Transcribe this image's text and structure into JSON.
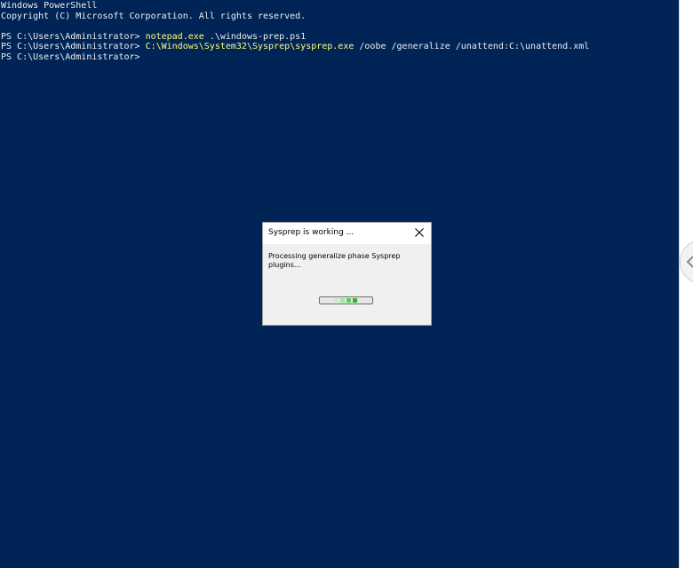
{
  "console": {
    "lines": [
      {
        "prompt": "Windows PowerShell",
        "cmd": "",
        "args": ""
      },
      {
        "prompt": "Copyright (C) Microsoft Corporation. All rights reserved.",
        "cmd": "",
        "args": ""
      },
      {
        "prompt": "",
        "cmd": "",
        "args": ""
      },
      {
        "prompt": "PS C:\\Users\\Administrator> ",
        "cmd": "notepad.exe",
        "args": " .\\windows-prep.ps1"
      },
      {
        "prompt": "PS C:\\Users\\Administrator> ",
        "cmd": "C:\\Windows\\System32\\Sysprep\\sysprep.exe",
        "args": " /oobe /generalize /unattend:C:\\unattend.xml"
      },
      {
        "prompt": "PS C:\\Users\\Administrator>",
        "cmd": "",
        "args": ""
      }
    ],
    "background": "#012456",
    "command_color": "#fefe7a"
  },
  "dialog": {
    "title": "Sysprep is working ...",
    "message": "Processing generalize phase Sysprep plugins...",
    "close_icon": "close-icon",
    "progress_state": "indeterminate-marquee"
  },
  "side_panel": {
    "icon": "chevron-left-icon"
  }
}
